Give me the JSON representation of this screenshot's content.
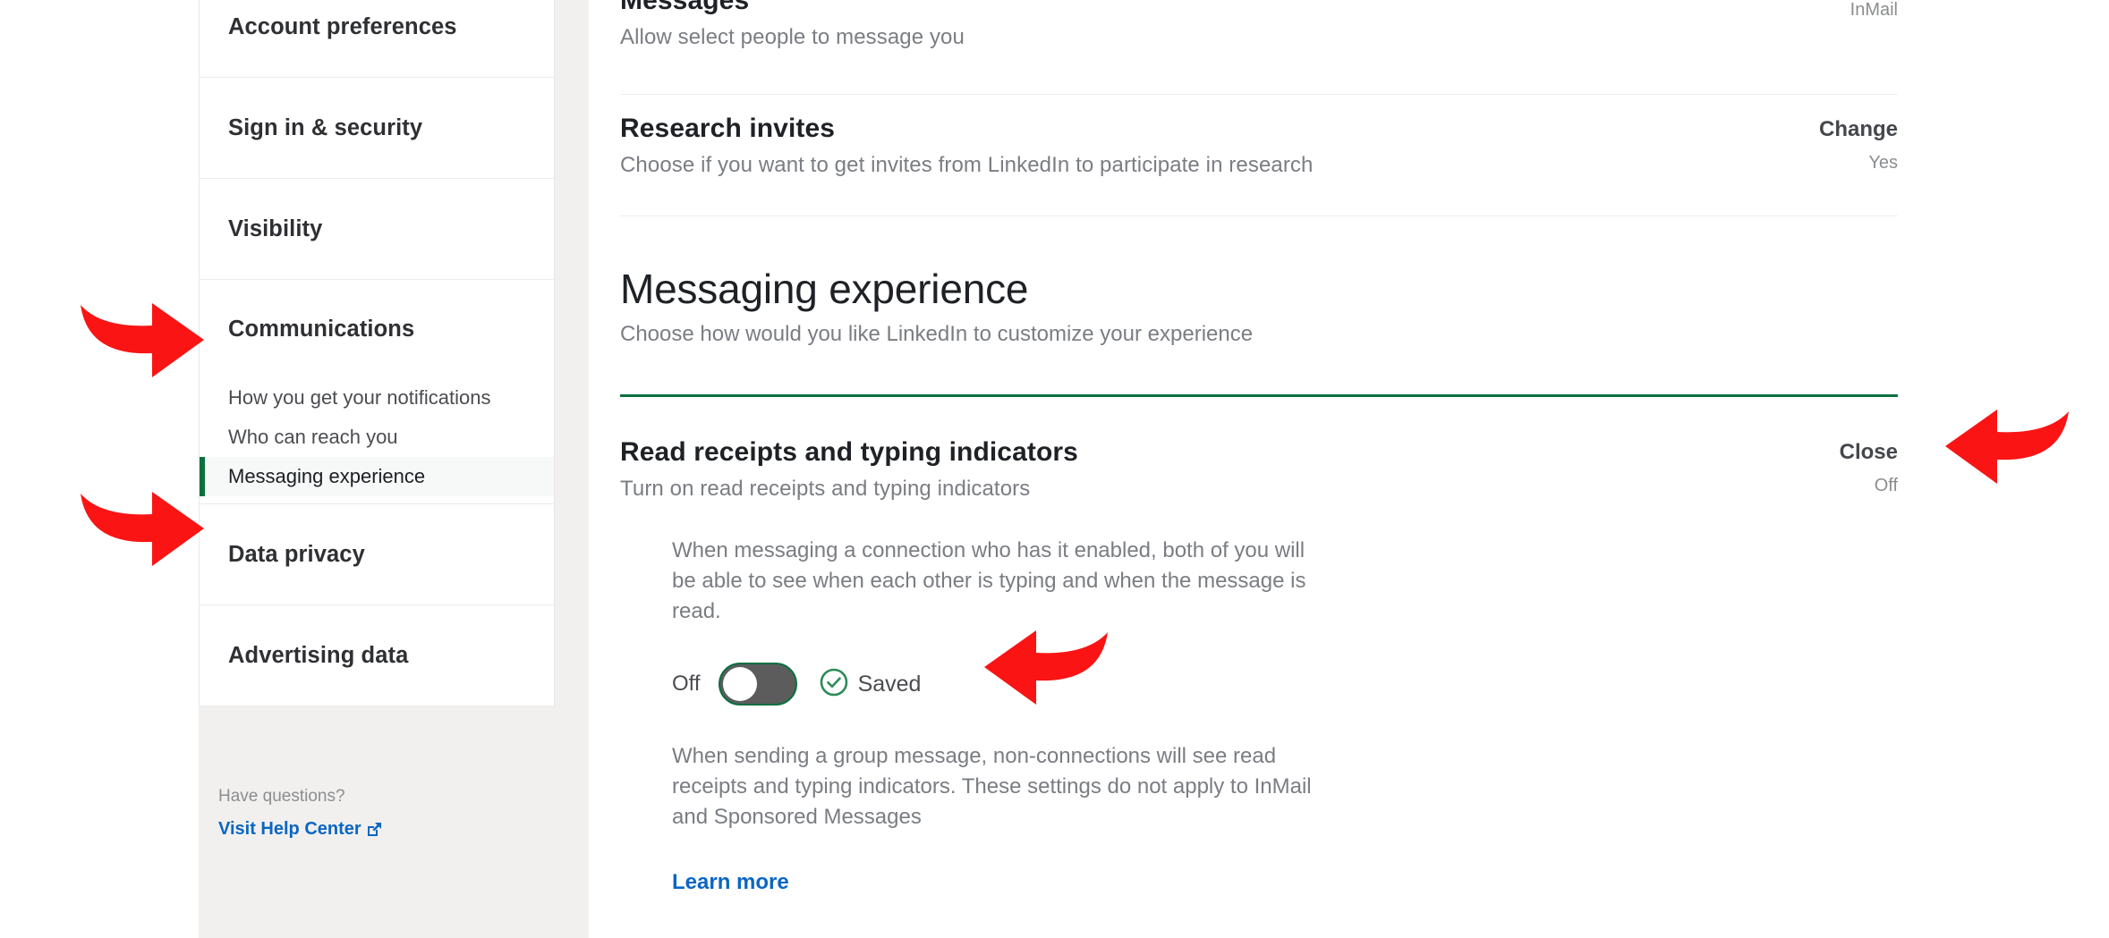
{
  "sidebar": {
    "top_items": [
      {
        "label": "Account preferences",
        "name": "account-preferences"
      },
      {
        "label": "Sign in & security",
        "name": "sign-in-security"
      },
      {
        "label": "Visibility",
        "name": "visibility"
      },
      {
        "label": "Communications",
        "name": "communications"
      },
      {
        "label": "Data privacy",
        "name": "data-privacy"
      },
      {
        "label": "Advertising data",
        "name": "advertising-data"
      }
    ],
    "sub_items": [
      {
        "label": "How you get your notifications",
        "active": false
      },
      {
        "label": "Who can reach you",
        "active": false
      },
      {
        "label": "Messaging experience",
        "active": true
      }
    ],
    "help_question": "Have questions?",
    "help_link": "Visit Help Center",
    "active_marker_color": "#0a7040"
  },
  "main": {
    "rows": [
      {
        "title": "Messages",
        "subtitle": "Allow select people to message you",
        "action": "",
        "value": "InMail"
      },
      {
        "title": "Research invites",
        "subtitle": "Choose if you want to get invites from LinkedIn to participate in research",
        "action": "Change",
        "value": "Yes"
      }
    ],
    "section": {
      "title": "Messaging experience",
      "subtitle": "Choose how would you like LinkedIn to customize your experience",
      "divider_color": "#0a7040"
    },
    "setting": {
      "title": "Read receipts and typing indicators",
      "subtitle": "Turn on read receipts and typing indicators",
      "action": "Close",
      "value": "Off",
      "paragraph_1": "When messaging a connection who has it enabled, both of you will be able to see when each other is typing and when the message is read.",
      "toggle_label": "Off",
      "toggle_state": "off",
      "saved_text": "Saved",
      "saved_color": "#0a7040",
      "paragraph_2": "When sending a group message, non-connections will see read receipts and typing indicators. These settings do not apply to InMail and Sponsored Messages",
      "learn_more": "Learn more"
    }
  },
  "annotations": {
    "color": "#fa1414",
    "arrows": [
      {
        "name": "arrow-to-communications",
        "direction": "right"
      },
      {
        "name": "arrow-to-messaging-experience",
        "direction": "right"
      },
      {
        "name": "arrow-to-close-action",
        "direction": "left"
      },
      {
        "name": "arrow-to-saved-status",
        "direction": "left"
      }
    ]
  }
}
